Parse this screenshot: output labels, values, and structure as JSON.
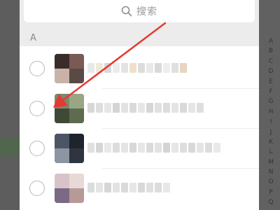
{
  "search": {
    "placeholder": "搜索"
  },
  "section": {
    "letter": "A"
  },
  "index_bar": [
    "A",
    "B",
    "C",
    "D",
    "E",
    "F",
    "G",
    "H",
    "I",
    "J",
    "K",
    "L",
    "M",
    "N",
    "O",
    "P",
    "Q"
  ],
  "contacts": [
    {
      "name": "",
      "selected": false,
      "avatar_colors": [
        "#4a3a38",
        "#7a5a55",
        "#c9b3a8",
        "#3a2c2a"
      ]
    },
    {
      "name": "",
      "selected": false,
      "avatar_colors": [
        "#5d6b4e",
        "#7c8a6a",
        "#3f4a36",
        "#9aa584"
      ]
    },
    {
      "name": "",
      "selected": false,
      "avatar_colors": [
        "#2e3440",
        "#4b5566",
        "#8d95a3",
        "#1e232c"
      ]
    },
    {
      "name": "",
      "selected": false,
      "avatar_colors": [
        "#b79a97",
        "#d8c4c8",
        "#7b6a86",
        "#e8d8d6"
      ]
    }
  ],
  "colors": {
    "panel_bg": "#ffffff",
    "section_bg": "#ececec",
    "overlay": "#5f5f5f",
    "annotation_arrow": "#e53935"
  }
}
